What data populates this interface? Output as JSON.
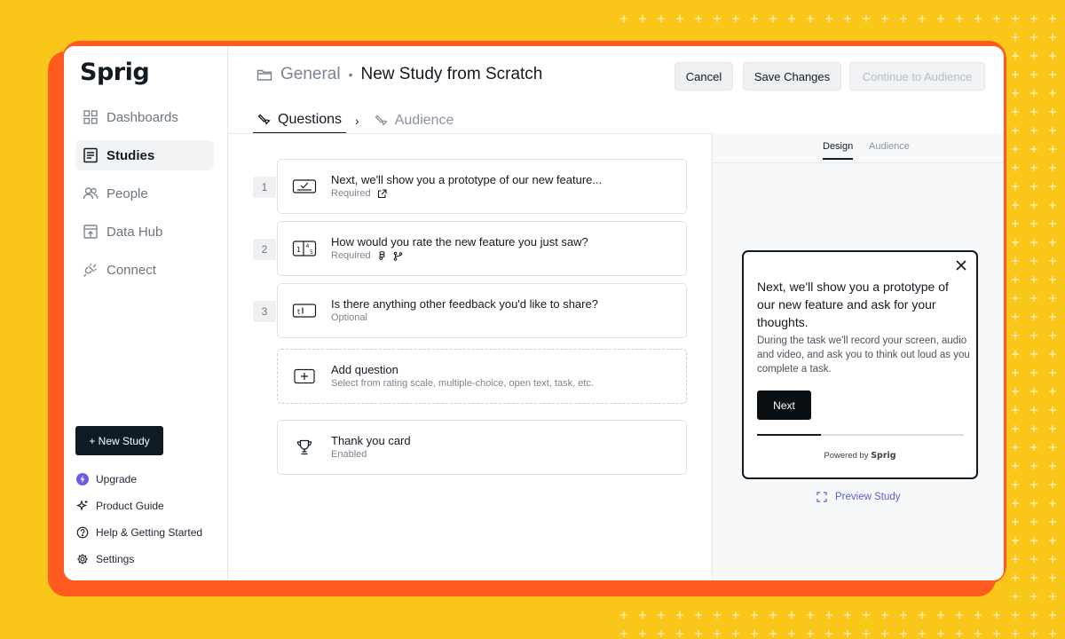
{
  "app": {
    "logo": "Sprig"
  },
  "sidebar": {
    "items": [
      {
        "label": "Dashboards",
        "icon": "grid-icon",
        "active": false
      },
      {
        "label": "Studies",
        "icon": "document-icon",
        "active": true
      },
      {
        "label": "People",
        "icon": "people-icon",
        "active": false
      },
      {
        "label": "Data Hub",
        "icon": "data-hub-icon",
        "active": false
      },
      {
        "label": "Connect",
        "icon": "plug-icon",
        "active": false
      }
    ],
    "new_study": "+ New Study",
    "links": [
      {
        "label": "Upgrade",
        "icon": "lightning-icon"
      },
      {
        "label": "Product Guide",
        "icon": "sparkle-icon"
      },
      {
        "label": "Help & Getting Started",
        "icon": "help-icon"
      },
      {
        "label": "Settings",
        "icon": "gear-icon"
      }
    ]
  },
  "header": {
    "breadcrumb_parent": "General",
    "breadcrumb_sep": "•",
    "title": "New Study from Scratch",
    "cancel": "Cancel",
    "save": "Save Changes",
    "continue": "Continue to Audience"
  },
  "tabs": {
    "questions": "Questions",
    "sep": "›",
    "audience": "Audience"
  },
  "questions": [
    {
      "number": "1",
      "title": "Next, we'll show you a prototype of our new feature...",
      "subtitle": "Required",
      "icon": "prototype-task-icon"
    },
    {
      "number": "2",
      "title": "How would you rate the new feature you just saw?",
      "subtitle": "Required",
      "icon": "rating-scale-icon"
    },
    {
      "number": "3",
      "title": "Is there anything other feedback you'd like to share?",
      "subtitle": "Optional",
      "icon": "open-text-icon"
    }
  ],
  "add_question": {
    "title": "Add question",
    "subtitle": "Select from rating scale, multiple-choice, open text, task, etc."
  },
  "thank_you": {
    "title": "Thank you card",
    "subtitle": "Enabled"
  },
  "preview": {
    "tabs": {
      "design": "Design",
      "audience": "Audience"
    },
    "card": {
      "title": "Next, we'll show you a prototype of our new feature and ask for your thoughts.",
      "body": "During the task we'll record your screen, audio and video, and ask you to think out loud as you complete a task.",
      "button": "Next",
      "progress": 0.31,
      "powered_by": "Powered by",
      "brand": "Sprig"
    },
    "preview_link": "Preview Study"
  },
  "colors": {
    "background": "#FAC61A",
    "frame": "#FF5A1F",
    "accent_link": "#5b5fd1",
    "primary_button": "#0f1b24"
  }
}
